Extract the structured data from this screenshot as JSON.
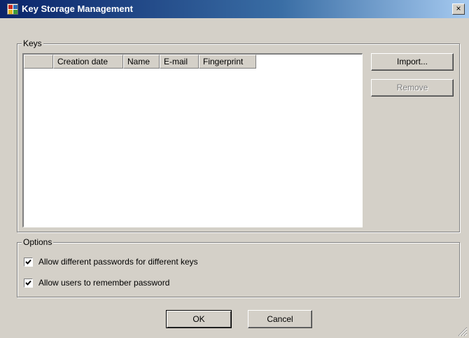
{
  "window": {
    "title": "Key Storage Management",
    "close_label": "×"
  },
  "keys_group": {
    "label": "Keys",
    "columns": [
      "",
      "Creation date",
      "Name",
      "E-mail",
      "Fingerprint"
    ],
    "rows": []
  },
  "buttons": {
    "import_label": "Import...",
    "remove_label": "Remove",
    "remove_enabled": false
  },
  "options_group": {
    "label": "Options",
    "checkboxes": [
      {
        "label": "Allow different passwords for different keys",
        "checked": true
      },
      {
        "label": "Allow users to remember password",
        "checked": true
      }
    ]
  },
  "footer": {
    "ok_label": "OK",
    "cancel_label": "Cancel"
  }
}
